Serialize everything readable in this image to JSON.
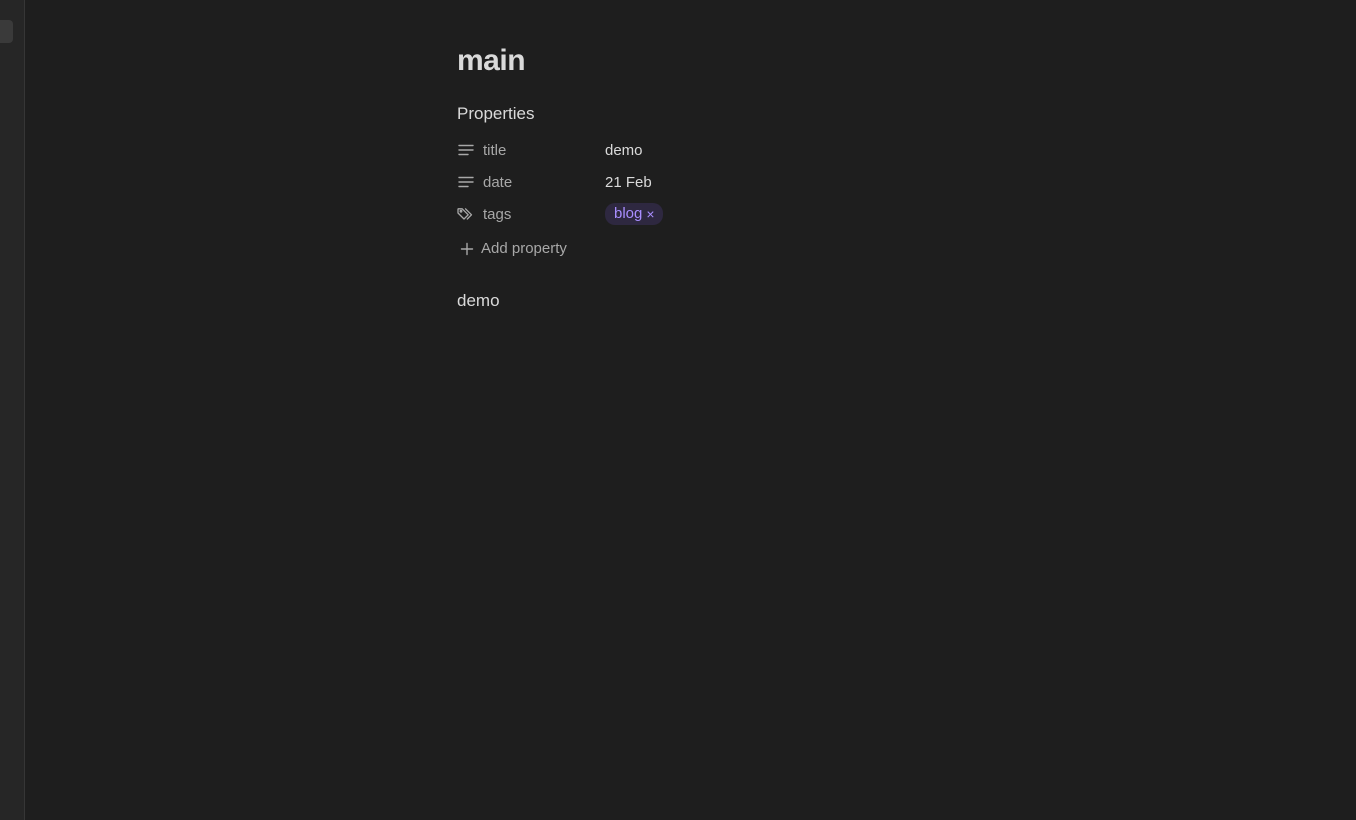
{
  "note": {
    "title": "main",
    "body": "demo"
  },
  "properties": {
    "heading": "Properties",
    "items": [
      {
        "key": "title",
        "value": "demo",
        "icon": "text-lines-icon"
      },
      {
        "key": "date",
        "value": "21 Feb",
        "icon": "text-lines-icon"
      },
      {
        "key": "tags",
        "icon": "tags-icon",
        "tags": [
          {
            "label": "blog",
            "remove": "×"
          }
        ]
      }
    ],
    "add_label": "Add property"
  },
  "colors": {
    "background": "#1e1e1e",
    "text": "#dadada",
    "muted": "#a8a8a8",
    "tag_text": "#a98eff",
    "tag_bg": "#2e2840"
  }
}
